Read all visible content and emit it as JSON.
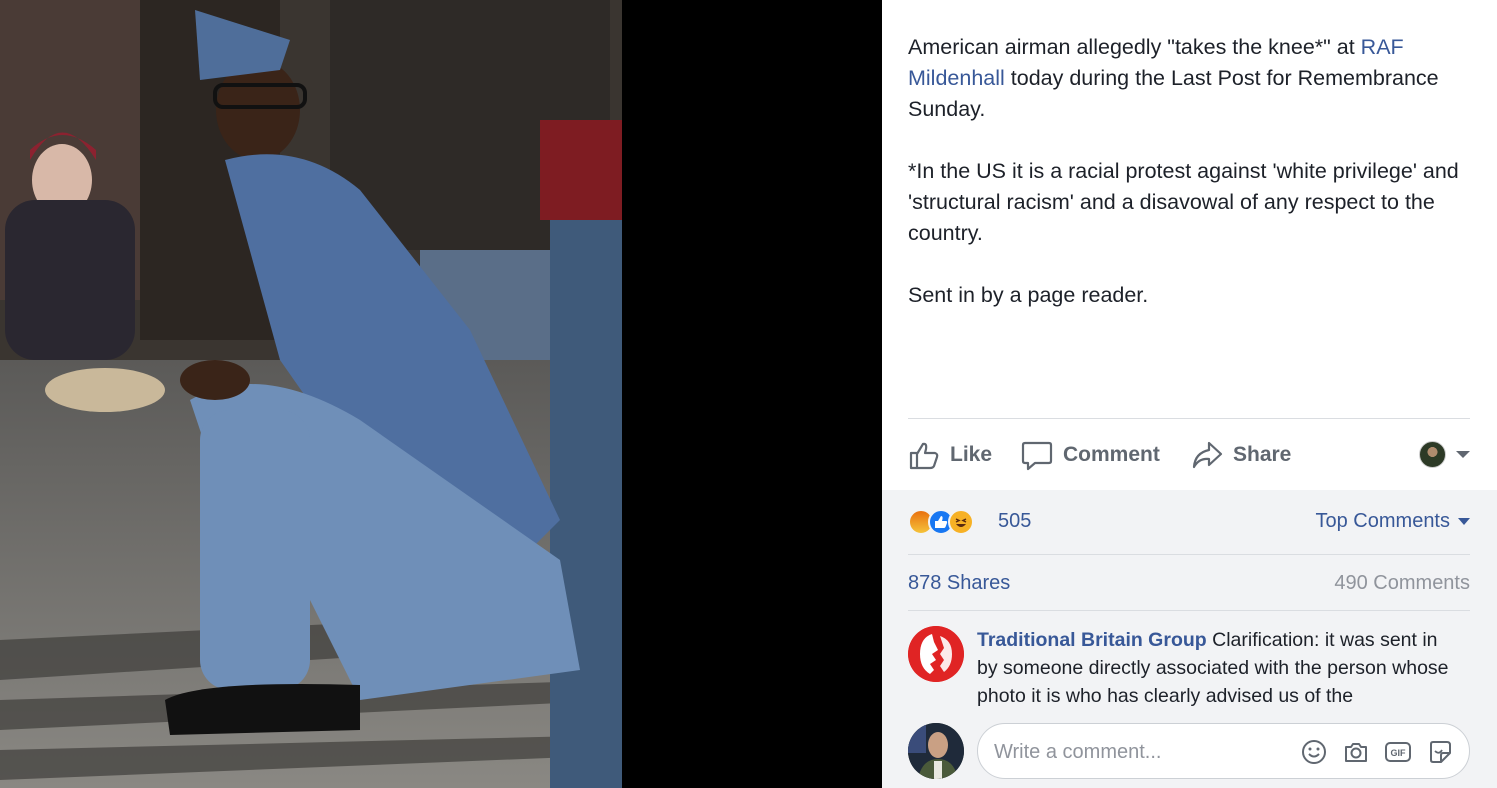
{
  "post": {
    "caption_line1_pre": "American airman allegedly \"takes the knee*\" at ",
    "caption_link": "RAF Mildenhall",
    "caption_line1_post": " today during the Last Post for Remembrance Sunday.",
    "caption_para2": "*In the US it is a racial protest against 'white privilege' and 'structural racism' and a disavowal of any respect to the country.",
    "caption_para3": "Sent in by a page reader."
  },
  "actions": {
    "like": "Like",
    "comment": "Comment",
    "share": "Share"
  },
  "feedback": {
    "reaction_count": "505",
    "reactions": [
      "angry",
      "like",
      "haha"
    ],
    "sort_label": "Top Comments",
    "shares": "878 Shares",
    "comments": "490 Comments"
  },
  "top_comment": {
    "author": "Traditional Britain Group",
    "text": "Clarification: it was sent in by someone directly associated with the person whose photo it is who has clearly advised us of the"
  },
  "composer": {
    "placeholder": "Write a comment...",
    "tools": [
      "emoji-icon",
      "camera-icon",
      "gif-icon",
      "sticker-icon"
    ]
  },
  "colors": {
    "link": "#385898",
    "text": "#1d2129",
    "muted": "#606770",
    "feedback_bg": "#f2f3f5"
  }
}
